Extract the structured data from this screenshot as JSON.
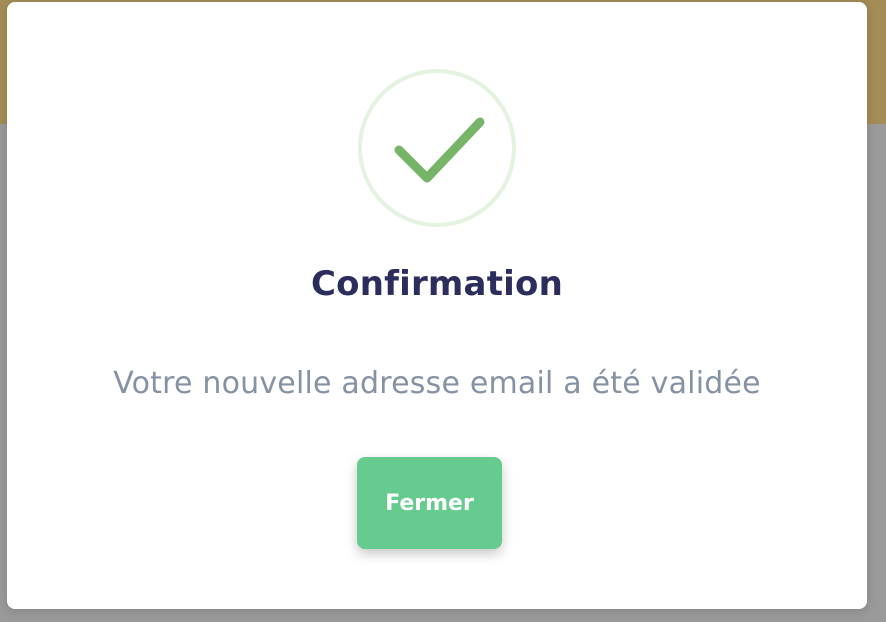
{
  "colors": {
    "backdrop": "#9a9a9a",
    "backdrop_top": "#a38c55",
    "modal_bg": "#ffffff",
    "check": "#76b567",
    "check_ring": "#e4f2e0",
    "title": "#2b2d5c",
    "message": "#8592a3",
    "button_bg": "#66cb8f",
    "button_text": "#ffffff"
  },
  "modal": {
    "icon": "check-icon",
    "title": "Confirmation",
    "message": "Votre nouvelle adresse email a été validée",
    "close_button_label": "Fermer"
  }
}
